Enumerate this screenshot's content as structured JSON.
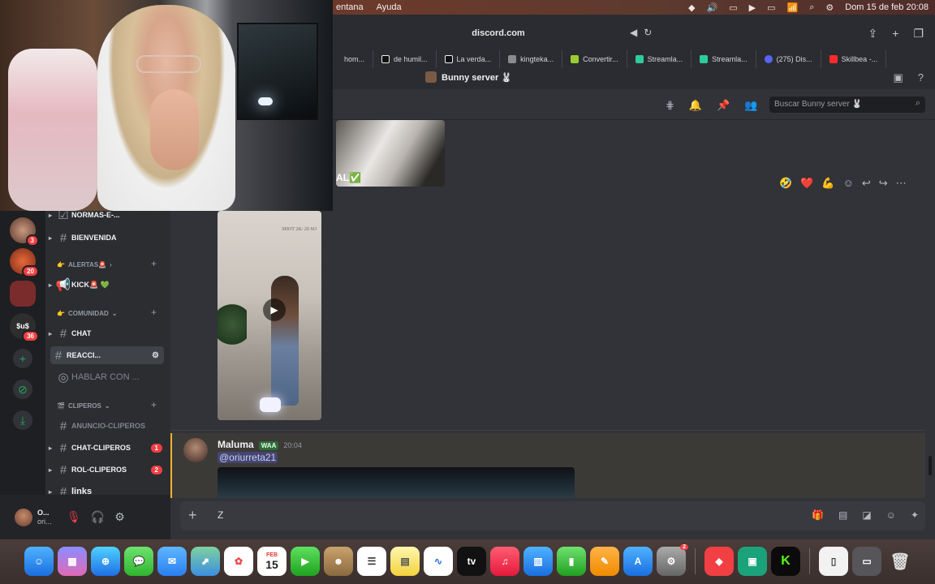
{
  "menubar": {
    "items": [
      "entana",
      "Ayuda"
    ],
    "datetime": "Dom 15 de feb  20:08"
  },
  "browser": {
    "url": "discord.com",
    "tabs": [
      {
        "label": "hom...",
        "color": "#999999"
      },
      {
        "label": "de humil...",
        "color": "#111111"
      },
      {
        "label": "La verda...",
        "color": "#111111"
      },
      {
        "label": "kingteka...",
        "color": "#8b8b8b"
      },
      {
        "label": "Convertir...",
        "color": "#9acd32"
      },
      {
        "label": "Streamla...",
        "color": "#2ecc9a"
      },
      {
        "label": "Streamla...",
        "color": "#2ecc9a"
      },
      {
        "label": "(275) Dis...",
        "color": "#5865f2"
      },
      {
        "label": "Skillbea -...",
        "color": "#ff2a2a"
      }
    ],
    "page_title": "Bunny server 🐰"
  },
  "server_rail": {
    "servers": [
      {
        "badge": "3",
        "color": "#8a5a4a"
      },
      {
        "badge": "20",
        "color": "#c2492f"
      },
      {
        "badge": "",
        "color": "#7a2b2b"
      },
      {
        "badge": "36",
        "color": "#2e2e2e",
        "label": "$u$"
      }
    ]
  },
  "channels": {
    "normas": "NORMAS-E-...",
    "bienvenida": "BIENVENIDA",
    "cat_alertas": "ALERTAS🚨",
    "kick": "KICK🚨 💚",
    "cat_comunidad": "COMUNIDAD",
    "chat": "CHAT",
    "reacciones": "REACCI...",
    "voice": "HABLAR CON ...",
    "cat_clipperos": "CLIPEROS",
    "anuncio": "ANUNCIO-CLIPEROS",
    "chat_clipperos": "CHAT-CLIPEROS",
    "chat_clipperos_badge": "1",
    "rol_clipperos": "ROL-CLIPEROS",
    "rol_clipperos_badge": "2",
    "links": "links"
  },
  "user_panel": {
    "name": "O...",
    "sub": "ori..."
  },
  "chat": {
    "search_placeholder": "Buscar Bunny server 🐰",
    "image_label": "AL✅",
    "reactions": [
      "🤣",
      "❤️",
      "💪"
    ],
    "video_overlay_text": "SHOT 2K/ 20 SO",
    "message": {
      "author": "Maluma",
      "tag": "WAA",
      "time": "20:04",
      "mention": "@oriurreta21"
    },
    "composer_text": "Z"
  },
  "dock": {
    "calendar_day": "15",
    "calendar_month": "FEB",
    "notif_badge": "2"
  }
}
